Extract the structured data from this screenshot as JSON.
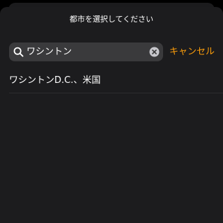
{
  "header": {
    "title": "都市を選択してください"
  },
  "search": {
    "value": "ワシントン",
    "cancel_label": "キャンセル",
    "search_icon": "magnifying-glass",
    "clear_icon": "x-circle-fill"
  },
  "results": [
    {
      "label": "ワシントンD.C.、米国"
    }
  ],
  "colors": {
    "background": "#000000",
    "sheet": "#1c1c1e",
    "search_field": "#3a3a3c",
    "accent": "#ff9f0a",
    "text": "#ffffff"
  }
}
